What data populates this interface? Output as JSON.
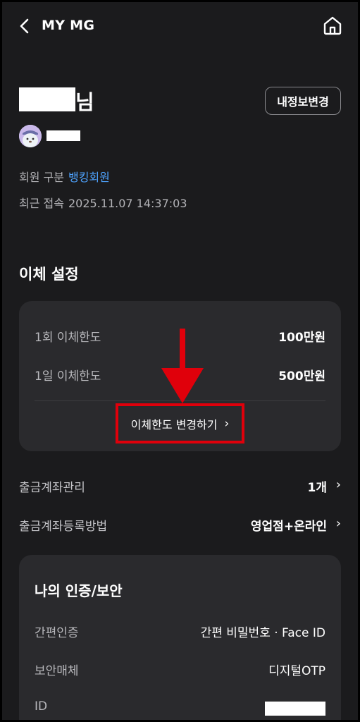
{
  "header": {
    "title": "MY MG",
    "back_icon": "chevron-left-icon",
    "home_icon": "home-icon"
  },
  "profile": {
    "name_suffix": "님",
    "edit_button_label": "내정보변경",
    "member_type_label": "회원 구분",
    "member_type_value": "뱅킹회원",
    "last_login_label": "최근 접속",
    "last_login_value": "2025.11.07 14:37:03"
  },
  "transfer": {
    "section_title": "이체 설정",
    "per_transaction_label": "1회 이체한도",
    "per_transaction_value": "100만원",
    "daily_label": "1일 이체한도",
    "daily_value": "500만원",
    "change_limit_label": "이체한도 변경하기"
  },
  "accounts": {
    "withdrawal_account_label": "출금계좌관리",
    "withdrawal_account_value": "1개",
    "registration_method_label": "출금계좌등록방법",
    "registration_method_value": "영업점+온라인"
  },
  "security": {
    "title": "나의 인증/보안",
    "simple_auth_label": "간편인증",
    "simple_auth_value": "간편 비밀번호 · Face ID",
    "security_media_label": "보안매체",
    "security_media_value": "디지털OTP",
    "id_label": "ID"
  },
  "colors": {
    "background": "#1b1b1d",
    "card": "#2a2a2d",
    "accent": "#4ea3ff",
    "highlight": "#e0000b"
  }
}
